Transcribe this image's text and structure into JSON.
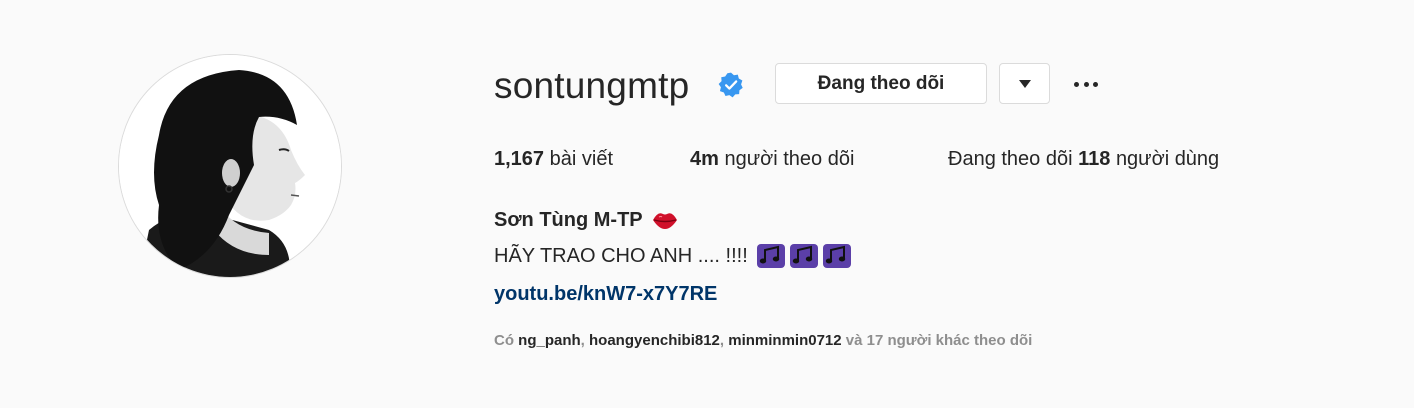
{
  "profile": {
    "username": "sontungmtp",
    "verified_icon": "verified-badge-icon",
    "follow_button_label": "Đang theo dõi",
    "dropdown_icon": "caret-down-icon",
    "more_icon": "more-options-icon",
    "full_name": "Sơn Tùng M-TP",
    "bio_text": "HÃY TRAO CHO ANH .... !!!!",
    "link": "youtu.be/knW7-x7Y7RE",
    "accent_color": "#3897f0",
    "link_color": "#003569"
  },
  "stats": {
    "posts_count": "1,167",
    "posts_label": "bài viết",
    "followers_count": "4m",
    "followers_label": "người theo dõi",
    "following_prefix": "Đang theo dõi",
    "following_count": "118",
    "following_suffix": "người dùng"
  },
  "followed_by": {
    "prefix": "Có",
    "users": [
      "ng_panh",
      "hoangyenchibi812",
      "minminmin0712"
    ],
    "separator": ", ",
    "suffix": "và 17 người khác theo dõi"
  }
}
